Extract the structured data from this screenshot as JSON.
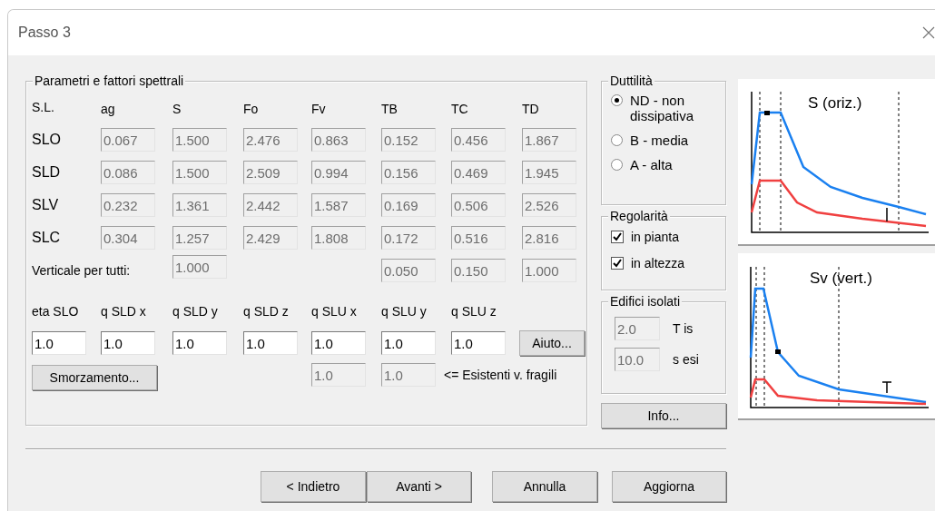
{
  "window": {
    "title": "Passo 3"
  },
  "parameters": {
    "title": "Parametri e fattori spettrali",
    "columns": [
      "S.L.",
      "ag",
      "S",
      "Fo",
      "Fv",
      "TB",
      "TC",
      "TD"
    ],
    "rows": [
      {
        "label": "SLO",
        "values": [
          "0.067",
          "1.500",
          "2.476",
          "0.863",
          "0.152",
          "0.456",
          "1.867"
        ]
      },
      {
        "label": "SLD",
        "values": [
          "0.086",
          "1.500",
          "2.509",
          "0.994",
          "0.156",
          "0.469",
          "1.945"
        ]
      },
      {
        "label": "SLV",
        "values": [
          "0.232",
          "1.361",
          "2.442",
          "1.587",
          "0.169",
          "0.506",
          "2.526"
        ]
      },
      {
        "label": "SLC",
        "values": [
          "0.304",
          "1.257",
          "2.429",
          "1.808",
          "0.172",
          "0.516",
          "2.816"
        ]
      }
    ],
    "vertical": {
      "label": "Verticale per tutti:",
      "s": "1.000",
      "tb": "0.050",
      "tc": "0.150",
      "td": "1.000"
    },
    "q_factors": [
      {
        "label": "eta SLO",
        "value": "1.0"
      },
      {
        "label": "q SLD x",
        "value": "1.0"
      },
      {
        "label": "q SLD y",
        "value": "1.0"
      },
      {
        "label": "q SLD z",
        "value": "1.0"
      },
      {
        "label": "q SLU x",
        "value": "1.0"
      },
      {
        "label": "q SLU y",
        "value": "1.0"
      },
      {
        "label": "q SLU z",
        "value": "1.0"
      }
    ],
    "help_button": "Aiuto...",
    "damping_button": "Smorzamento...",
    "fragile": {
      "values": [
        "1.0",
        "1.0"
      ],
      "note": "<= Esistenti v. fragili"
    }
  },
  "ductility": {
    "title": "Duttilità",
    "options": [
      {
        "label": "ND - non dissipativa",
        "selected": true
      },
      {
        "label": "B - media",
        "selected": false
      },
      {
        "label": "A - alta",
        "selected": false
      }
    ]
  },
  "regularity": {
    "title": "Regolarità",
    "options": [
      {
        "label": "in pianta",
        "checked": true
      },
      {
        "label": "in altezza",
        "checked": true
      }
    ]
  },
  "isolated": {
    "title": "Edifici isolati",
    "fields": [
      {
        "value": "2.0",
        "label": "T is"
      },
      {
        "value": "10.0",
        "label": "s esi"
      }
    ]
  },
  "info_button": "Info...",
  "plots": [
    {
      "title": "S (oriz.)"
    },
    {
      "title": "Sv (vert.)"
    }
  ],
  "nav_buttons": [
    "< Indietro",
    "Avanti >",
    "Annulla",
    "Aggiorna"
  ]
}
